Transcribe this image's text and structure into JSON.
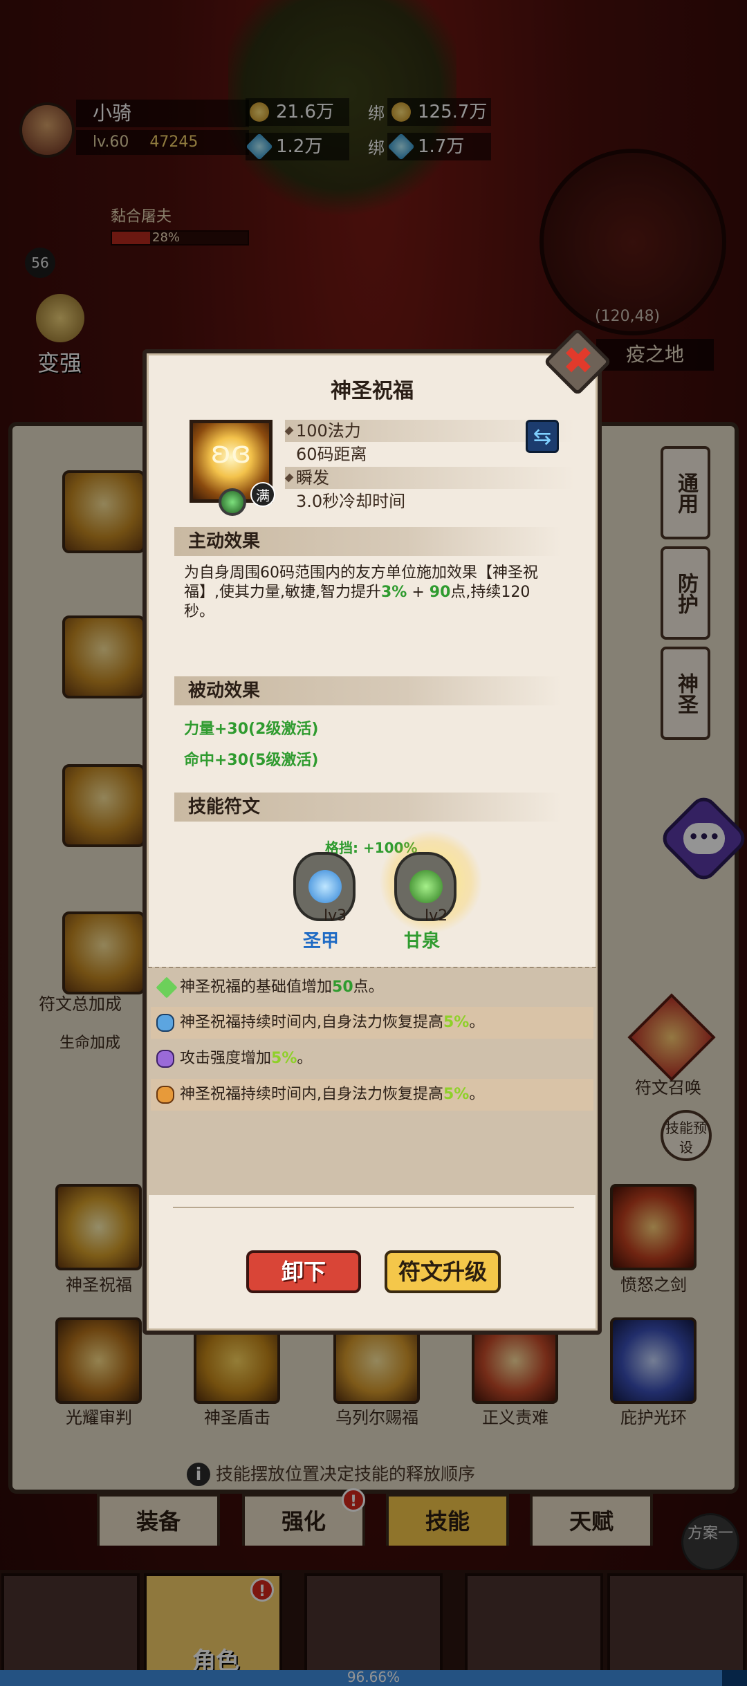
{
  "player": {
    "name": "小骑",
    "level": "lv.60",
    "power": "47245",
    "gold": "21.6万",
    "gems": "1.2万",
    "bound_label_1": "绑",
    "bound_gold": "125.7万",
    "bound_label_2": "绑",
    "bound_gems": "1.7万",
    "level_badge": "56"
  },
  "buff": {
    "name": "黏合屠夫",
    "percent": "28%",
    "fill": 0.28
  },
  "map": {
    "coord": "(120,48)",
    "name": "疫之地"
  },
  "side": {
    "strengthen": "变强"
  },
  "dialog": {
    "title": "神圣祝福",
    "close": "✖",
    "icon_badge": "满",
    "stats": [
      "100法力",
      "60码距离",
      "瞬发",
      "3.0秒冷却时间"
    ],
    "active_header": "主动效果",
    "active_desc_1": "为自身周围60码范围内的友方单位施加效果【神圣祝福】,使其力量,敏捷,智力提升",
    "active_val_1": "3%",
    "active_plus": " + ",
    "active_val_2": "90",
    "active_desc_2": "点,持续120秒。",
    "passive_header": "被动效果",
    "passives": [
      "力量+30(2级激活)",
      "命中+30(5级激活)"
    ],
    "rune_header": "技能符文",
    "rune_bonus": "格挡: +100%",
    "runes": [
      {
        "lv": "lv3",
        "name": "圣甲"
      },
      {
        "lv": "lv2",
        "name": "甘泉"
      }
    ],
    "effects": [
      {
        "text": "神圣祝福的基础值增加",
        "value": "50",
        "suffix": "点。"
      },
      {
        "text": "神圣祝福持续时间内,自身法力恢复提高",
        "value": "5%",
        "suffix": "。"
      },
      {
        "text": "攻击强度增加",
        "value": "5%",
        "suffix": "。"
      },
      {
        "text": "神圣祝福持续时间内,自身法力恢复提高",
        "value": "5%",
        "suffix": "。"
      }
    ],
    "btn_unequip": "卸下",
    "btn_upgrade": "符文升级"
  },
  "page": {
    "rune_total": "符文总加成",
    "life_add": "生命加成",
    "tabs": [
      "通用",
      "防护",
      "神圣"
    ],
    "rune_summon": "符文召唤",
    "preset": "技能预设",
    "slots_row1": [
      "神圣祝福",
      "",
      "",
      "",
      "愤怒之剑"
    ],
    "slots_row2": [
      "光耀审判",
      "神圣盾击",
      "乌列尔赐福",
      "正义责难",
      "庇护光环"
    ],
    "tip": "技能摆放位置决定技能的释放顺序",
    "nav_tabs": [
      "装备",
      "强化",
      "技能",
      "天赋"
    ],
    "scheme": "方案一",
    "bottom_active": "角色",
    "alert": "!"
  },
  "xp": {
    "percent": "96.66%",
    "fill": 0.9666
  }
}
